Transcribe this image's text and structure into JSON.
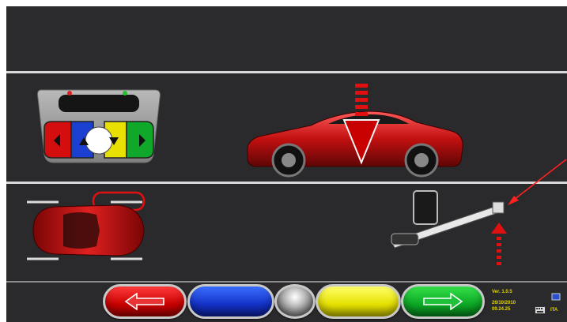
{
  "status": {
    "version": "Ver. 1.0.5",
    "date": "26/10/2010",
    "time": "09.24.25",
    "language": "ITA"
  },
  "toolbar": {
    "buttons": [
      {
        "name": "back",
        "color": "#c90000",
        "icon": "arrow-left-icon"
      },
      {
        "name": "blue",
        "color": "#1432c8",
        "icon": ""
      },
      {
        "name": "center",
        "color": "#9a9a9a",
        "icon": ""
      },
      {
        "name": "yellow",
        "color": "#e6e200",
        "icon": ""
      },
      {
        "name": "next",
        "color": "#0ca825",
        "icon": "arrow-right-icon"
      }
    ]
  },
  "colors": {
    "background": "#2a2a2c",
    "divider": "#d9d9d9",
    "car": "#c21010",
    "arrow": "#d40000",
    "status_text": "#e2d400"
  },
  "icons": [
    "remote-control-icon",
    "car-side-icon",
    "down-arrow-icon",
    "car-top-view-icon",
    "sensor-head-icon",
    "up-arrow-icon",
    "pointer-arrow-icon",
    "keyboard-icon",
    "language-icon"
  ]
}
